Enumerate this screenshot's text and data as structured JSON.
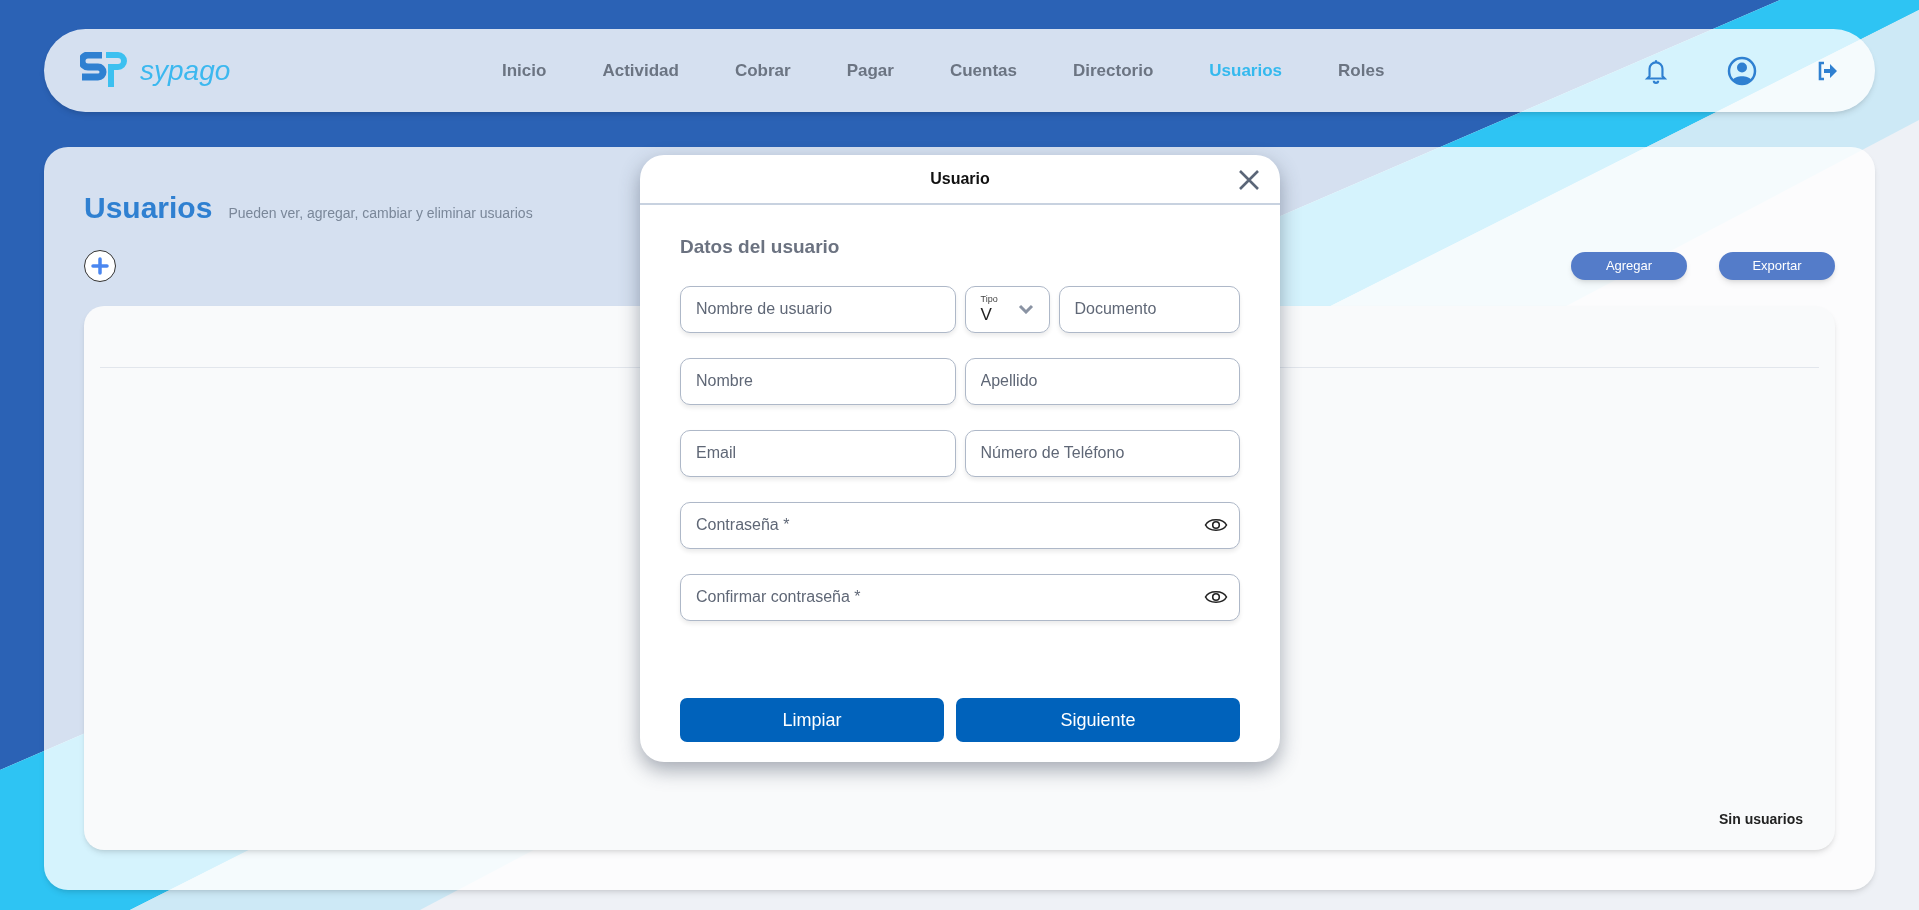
{
  "brand": {
    "name": "sypago"
  },
  "nav": [
    {
      "label": "Inicio",
      "selected": false
    },
    {
      "label": "Actividad",
      "selected": false
    },
    {
      "label": "Cobrar",
      "selected": false
    },
    {
      "label": "Pagar",
      "selected": false
    },
    {
      "label": "Cuentas",
      "selected": false
    },
    {
      "label": "Directorio",
      "selected": false
    },
    {
      "label": "Usuarios",
      "selected": true
    },
    {
      "label": "Roles",
      "selected": false
    }
  ],
  "page": {
    "title": "Usuarios",
    "subtitle": "Pueden ver, agregar, cambiar y eliminar usuarios",
    "buttons": [
      "Agregar",
      "Exportar"
    ],
    "empty_message": "Sin usuarios"
  },
  "modal": {
    "title": "Usuario",
    "section": "Datos del usuario",
    "rows": [
      [
        {
          "kind": "text",
          "placeholder": "Nombre de usuario"
        },
        {
          "kind": "select",
          "label": "Tipo",
          "value": "V"
        },
        {
          "kind": "text",
          "placeholder": "Documento"
        }
      ],
      [
        {
          "kind": "text",
          "placeholder": "Nombre"
        },
        {
          "kind": "text",
          "placeholder": "Apellido"
        }
      ],
      [
        {
          "kind": "text",
          "placeholder": "Email"
        },
        {
          "kind": "text",
          "placeholder": "Número de Teléfono"
        }
      ],
      [
        {
          "kind": "password",
          "placeholder": "Contraseña *"
        }
      ],
      [
        {
          "kind": "password",
          "placeholder": "Confirmar contraseña *"
        }
      ]
    ],
    "buttons": [
      "Limpiar",
      "Siguiente"
    ]
  }
}
